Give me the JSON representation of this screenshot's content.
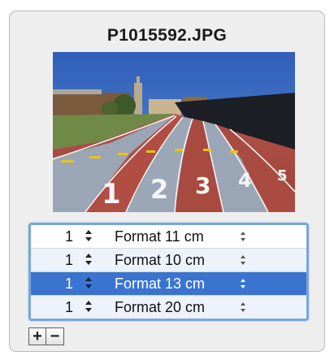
{
  "panel": {
    "filename": "P1015592.JPG"
  },
  "formats": {
    "rows": [
      {
        "quantity": "1",
        "format": "Format 11 cm",
        "selected": false
      },
      {
        "quantity": "1",
        "format": "Format 10 cm",
        "selected": false
      },
      {
        "quantity": "1",
        "format": "Format 13 cm",
        "selected": true
      },
      {
        "quantity": "1",
        "format": "Format 20 cm",
        "selected": false
      }
    ]
  },
  "buttons": {
    "add_label": "+",
    "remove_label": "−"
  },
  "icons": {
    "stepper": "up-down-arrows-icon"
  },
  "colors": {
    "selection": "#3a74cf",
    "focus_ring": "#78a6da",
    "alt_row": "#eef3fb"
  }
}
